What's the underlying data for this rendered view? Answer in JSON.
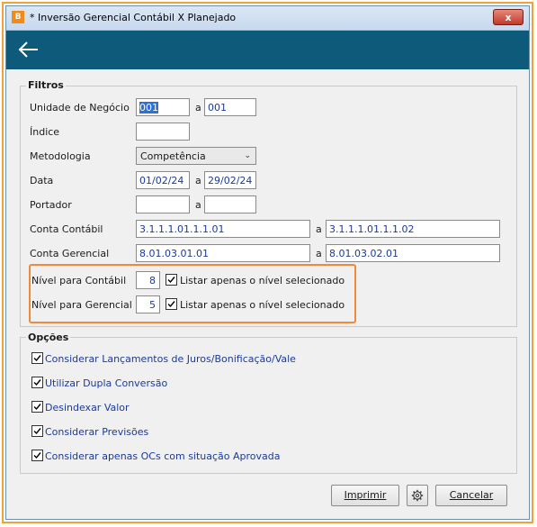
{
  "window": {
    "title": "* Inversão Gerencial Contábil X Planejado",
    "close_label": "x",
    "app_icon": "bomber-logo-icon"
  },
  "nav": {
    "back_icon": "arrow-left-icon"
  },
  "filtros": {
    "title": "Filtros",
    "separator": "a",
    "unidade": {
      "label": "Unidade de Negócio",
      "from": "001",
      "to": "001"
    },
    "indice": {
      "label": "Índice",
      "value": ""
    },
    "metodologia": {
      "label": "Metodologia",
      "value": "Competência"
    },
    "data": {
      "label": "Data",
      "from": "01/02/24",
      "to": "29/02/24"
    },
    "portador": {
      "label": "Portador",
      "from": "",
      "to": ""
    },
    "conta_contabil": {
      "label": "Conta Contábil",
      "from": "3.1.1.1.01.1.1.01",
      "to": "3.1.1.1.01.1.1.02"
    },
    "conta_gerencial": {
      "label": "Conta Gerencial",
      "from": "8.01.03.01.01",
      "to": "8.01.03.02.01"
    },
    "nivel_contabil": {
      "label": "Nível para Contábil",
      "value": "8",
      "check_label": "Listar apenas o nível selecionado",
      "checked": true
    },
    "nivel_gerencial": {
      "label": "Nível para Gerencial",
      "value": "5",
      "check_label": "Listar apenas o nível selecionado",
      "checked": true
    }
  },
  "opcoes": {
    "title": "Opções",
    "items": [
      {
        "label": "Considerar Lançamentos de Juros/Bonificação/Vale",
        "checked": true
      },
      {
        "label": "Utilizar Dupla Conversão",
        "checked": true
      },
      {
        "label": "Desindexar Valor",
        "checked": true
      },
      {
        "label": "Considerar Previsões",
        "checked": true
      },
      {
        "label": "Considerar apenas OCs com situação Aprovada",
        "checked": true
      }
    ]
  },
  "buttons": {
    "print": "Imprimir",
    "settings_icon": "gear-icon",
    "cancel": "Cancelar"
  },
  "colors": {
    "nav": "#0e5a7a",
    "highlight": "#f08a3a",
    "link_text": "#1a3a9a"
  }
}
